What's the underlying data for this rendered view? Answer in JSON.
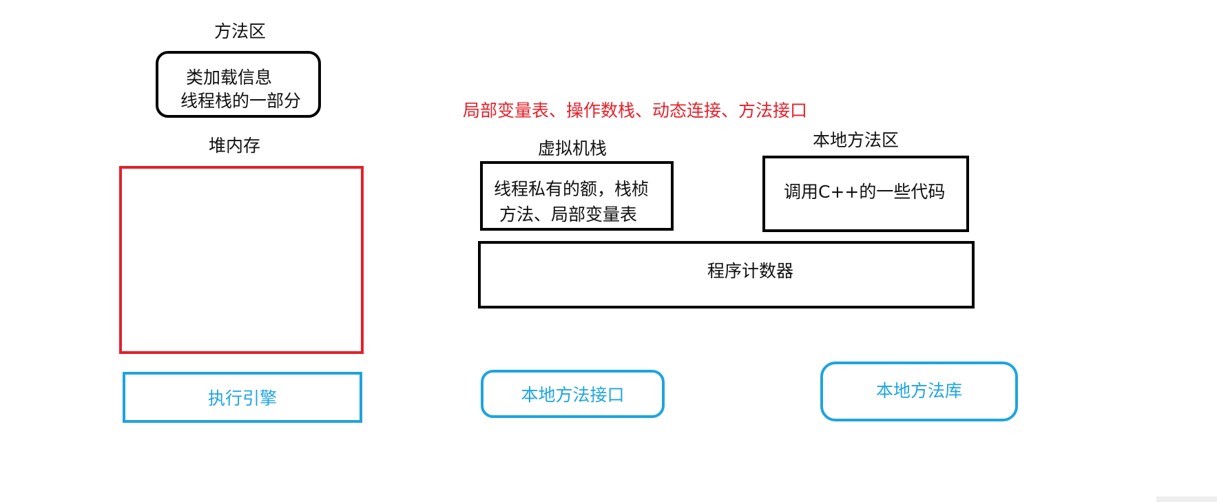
{
  "method_area": {
    "title": "方法区",
    "line1": "类加载信息",
    "line2": "线程栈的一部分"
  },
  "heap": {
    "title": "堆内存"
  },
  "stack_note": "局部变量表、操作数栈、动态连接、方法接口",
  "vm_stack": {
    "title": "虚拟机栈",
    "line1": "线程私有的额，栈桢",
    "line2": "方法、局部变量表"
  },
  "native_method_area": {
    "title": "本地方法区",
    "text": "调用C++的一些代码"
  },
  "program_counter": {
    "text": "程序计数器"
  },
  "execution_engine": {
    "text": "执行引擎"
  },
  "native_interface": {
    "text": "本地方法接口"
  },
  "native_library": {
    "text": "本地方法库"
  },
  "colors": {
    "border": "#000000",
    "heap_border": "#e5202a",
    "note_text": "#e5202a",
    "blue_boxes": "#1ea4e0"
  }
}
